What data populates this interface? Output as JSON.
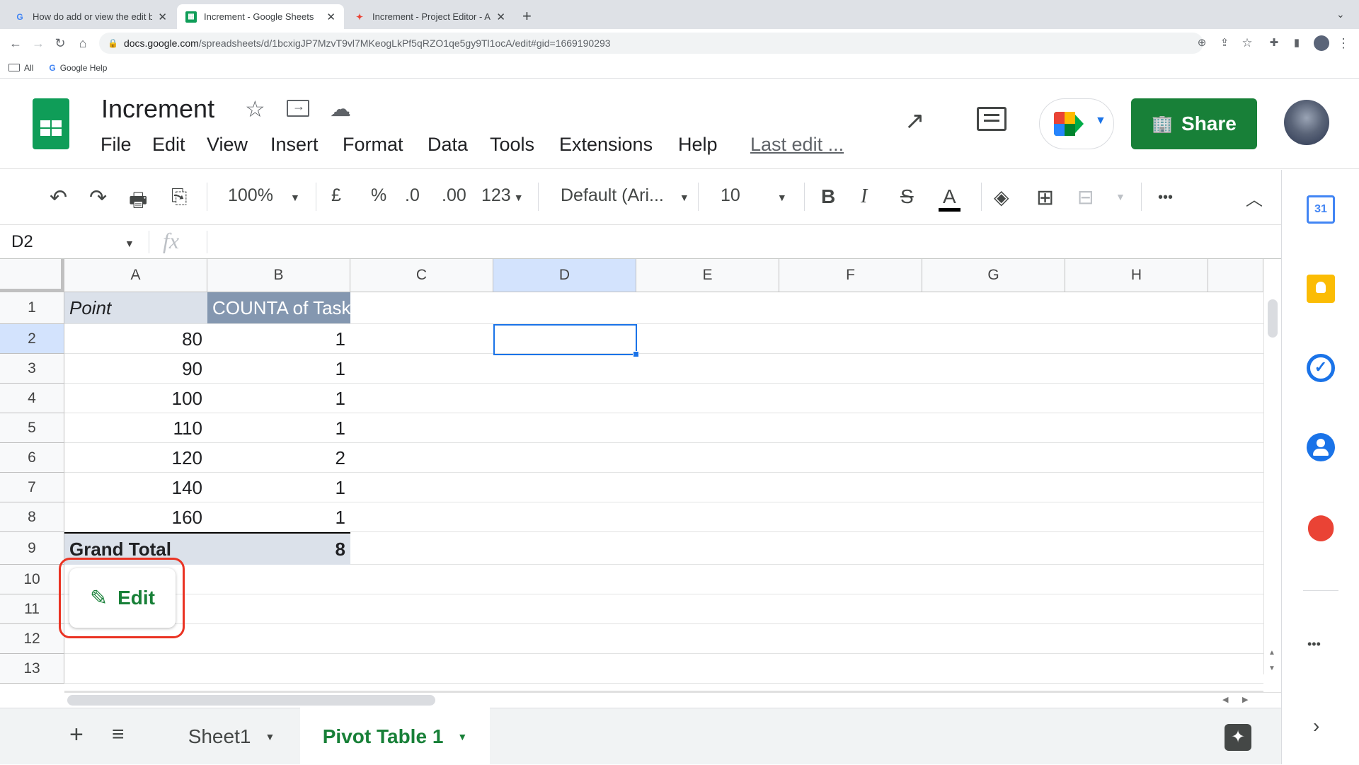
{
  "browser": {
    "tabs": [
      {
        "title": "How do add or view the edit bu",
        "icon": "google-g-icon"
      },
      {
        "title": "Increment - Google Sheets",
        "icon": "sheets-icon"
      },
      {
        "title": "Increment - Project Editor - Ap",
        "icon": "appsheet-icon"
      }
    ],
    "url_main": "docs.google.com",
    "url_rest": "/spreadsheets/d/1bcxigJP7MzvT9vl7MKeogLkPf5qRZO1qe5gy9Tl1ocA/edit#gid=1669190293",
    "bookmarks": [
      {
        "label": "All",
        "icon": "folder-icon"
      },
      {
        "label": "Google Help",
        "icon": "google-g-icon"
      }
    ]
  },
  "sheets": {
    "doc_title": "Increment",
    "menu": [
      "File",
      "Edit",
      "View",
      "Insert",
      "Format",
      "Data",
      "Tools",
      "Extensions",
      "Help"
    ],
    "last_edit": "Last edit ...",
    "share_label": "Share",
    "toolbar": {
      "zoom": "100%",
      "currency": "£",
      "percent": "%",
      "dec_decrease": ".0",
      "dec_increase": ".00",
      "number_format": "123",
      "font": "Default (Ari...",
      "font_size": "10",
      "bold": "B",
      "italic": "I",
      "strike": "S",
      "text_color": "A",
      "more": "•••"
    },
    "name_box": "D2",
    "fx": "fx",
    "columns": [
      "A",
      "B",
      "C",
      "D",
      "E",
      "F",
      "G",
      "H"
    ],
    "rows": [
      "1",
      "2",
      "3",
      "4",
      "5",
      "6",
      "7",
      "8",
      "9",
      "10",
      "11",
      "12",
      "13"
    ],
    "pivot": {
      "header_a": "Point",
      "header_b": "COUNTA of Task",
      "data": [
        {
          "point": "80",
          "count": "1"
        },
        {
          "point": "90",
          "count": "1"
        },
        {
          "point": "100",
          "count": "1"
        },
        {
          "point": "110",
          "count": "1"
        },
        {
          "point": "120",
          "count": "2"
        },
        {
          "point": "140",
          "count": "1"
        },
        {
          "point": "160",
          "count": "1"
        }
      ],
      "total_label": "Grand Total",
      "total_value": "8"
    },
    "edit_button": "Edit",
    "sheet_tabs": [
      {
        "label": "Sheet1",
        "active": false
      },
      {
        "label": "Pivot Table 1",
        "active": true
      }
    ]
  },
  "colors": {
    "accent_green": "#188038",
    "selection_blue": "#1a73e8",
    "pivot_header": "#8497b0",
    "pivot_total": "#dbe1ea",
    "highlight_red": "#ea3323"
  }
}
